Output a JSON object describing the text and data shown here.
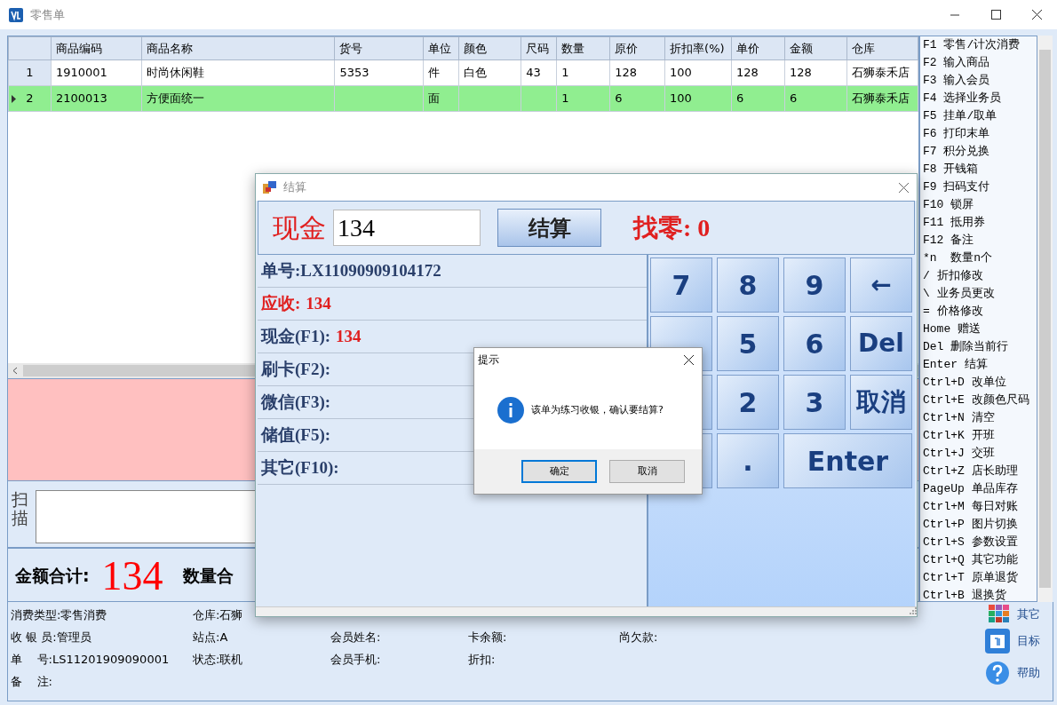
{
  "window": {
    "title": "零售单"
  },
  "table": {
    "columns": [
      "商品编码",
      "商品名称",
      "货号",
      "单位",
      "颜色",
      "尺码",
      "数量",
      "原价",
      "折扣率(%)",
      "单价",
      "金额",
      "仓库"
    ],
    "rows": [
      {
        "index": "1",
        "selected": false,
        "cells": [
          "1910001",
          "时尚休闲鞋",
          "5353",
          "件",
          "白色",
          "43",
          "1",
          "128",
          "100",
          "128",
          "128",
          "石狮泰禾店"
        ]
      },
      {
        "index": "2",
        "selected": true,
        "cells": [
          "2100013",
          "方便面统一",
          "",
          "面",
          "",
          "",
          "1",
          "6",
          "100",
          "6",
          "6",
          "石狮泰禾店"
        ]
      }
    ]
  },
  "scan": {
    "label": "扫描"
  },
  "totals": {
    "amount_label": "金额合计:",
    "amount": "134",
    "quantity_label": "数量合"
  },
  "shortcuts": [
    {
      "key": "F1",
      "label": "零售/计次消费"
    },
    {
      "key": "F2",
      "label": "输入商品"
    },
    {
      "key": "F3",
      "label": "输入会员"
    },
    {
      "key": "F4",
      "label": "选择业务员"
    },
    {
      "key": "F5",
      "label": "挂单/取单"
    },
    {
      "key": "F6",
      "label": "打印末单"
    },
    {
      "key": "F7",
      "label": "积分兑换"
    },
    {
      "key": "F8",
      "label": "开钱箱"
    },
    {
      "key": "F9",
      "label": "扫码支付"
    },
    {
      "key": "F10",
      "label": "锁屏"
    },
    {
      "key": "F11",
      "label": "抵用券"
    },
    {
      "key": "F12",
      "label": "备注"
    },
    {
      "key": "*n ",
      "label": "数量n个"
    },
    {
      "key": "/",
      "label": "折扣修改"
    },
    {
      "key": "\\",
      "label": "业务员更改"
    },
    {
      "key": "=",
      "label": "价格修改"
    },
    {
      "key": "Home",
      "label": "赠送"
    },
    {
      "key": "Del",
      "label": "删除当前行"
    },
    {
      "key": "Enter",
      "label": "结算"
    },
    {
      "key": "Ctrl+D",
      "label": "改单位"
    },
    {
      "key": "Ctrl+E",
      "label": "改颜色尺码"
    },
    {
      "key": "Ctrl+N",
      "label": "清空"
    },
    {
      "key": "Ctrl+K",
      "label": "开班"
    },
    {
      "key": "Ctrl+J",
      "label": "交班"
    },
    {
      "key": "Ctrl+Z",
      "label": "店长助理"
    },
    {
      "key": "PageUp",
      "label": "单品库存"
    },
    {
      "key": "Ctrl+M",
      "label": "每日对账"
    },
    {
      "key": "Ctrl+P",
      "label": "图片切换"
    },
    {
      "key": "Ctrl+S",
      "label": "参数设置"
    },
    {
      "key": "Ctrl+Q",
      "label": "其它功能"
    },
    {
      "key": "Ctrl+T",
      "label": "原单退货"
    },
    {
      "key": "Ctrl+B",
      "label": "退换货"
    }
  ],
  "info": [
    [
      "消费类型:零售消费",
      "仓库:石狮"
    ],
    [
      "收 银 员:管理员",
      "站点:A",
      "会员姓名:",
      "卡余额:",
      "尚欠款:"
    ],
    [
      "单    号:LS11201909090001",
      "状态:联机",
      "会员手机:",
      "折扣:"
    ],
    [
      "备    注:"
    ]
  ],
  "side_buttons": [
    {
      "kind": "apps",
      "label": "其它"
    },
    {
      "kind": "calendar",
      "label": "目标"
    },
    {
      "kind": "help",
      "label": "帮助"
    }
  ],
  "settle_dialog": {
    "title": "结算",
    "cash_label": "现金",
    "cash_value": "134",
    "settle_button": "结算",
    "change_label": "找零:",
    "change_value": "0",
    "lines": [
      {
        "kind": "plain",
        "label": "单号:LX11090909104172"
      },
      {
        "kind": "due",
        "label": "应收:",
        "value": "134"
      },
      {
        "kind": "plain",
        "label": "现金(F1):",
        "value": "134"
      },
      {
        "kind": "plain",
        "label": "刷卡(F2):"
      },
      {
        "kind": "plain",
        "label": "微信(F3):"
      },
      {
        "kind": "plain",
        "label": "储值(F5):"
      },
      {
        "kind": "plain",
        "label": "其它(F10):"
      }
    ],
    "keys": [
      {
        "kind": "digit",
        "label": "7"
      },
      {
        "kind": "digit",
        "label": "8"
      },
      {
        "kind": "digit",
        "label": "9"
      },
      {
        "kind": "action",
        "label": "←"
      },
      {
        "kind": "digit"
      },
      {
        "kind": "digit",
        "label": "5"
      },
      {
        "kind": "digit",
        "label": "6"
      },
      {
        "kind": "action",
        "label": "Del"
      },
      {
        "kind": "digit"
      },
      {
        "kind": "digit",
        "label": "2"
      },
      {
        "kind": "digit",
        "label": "3"
      },
      {
        "kind": "action",
        "label": "取消"
      },
      {
        "kind": "digit"
      },
      {
        "kind": "digit",
        "label": "."
      },
      {
        "kind": "wide",
        "label": "Enter"
      }
    ]
  },
  "prompt": {
    "title": "提示",
    "message": "该单为练习收银，确认要结算?",
    "buttons": [
      {
        "label": "确定",
        "default": true
      },
      {
        "label": "取消",
        "default": false
      }
    ]
  }
}
